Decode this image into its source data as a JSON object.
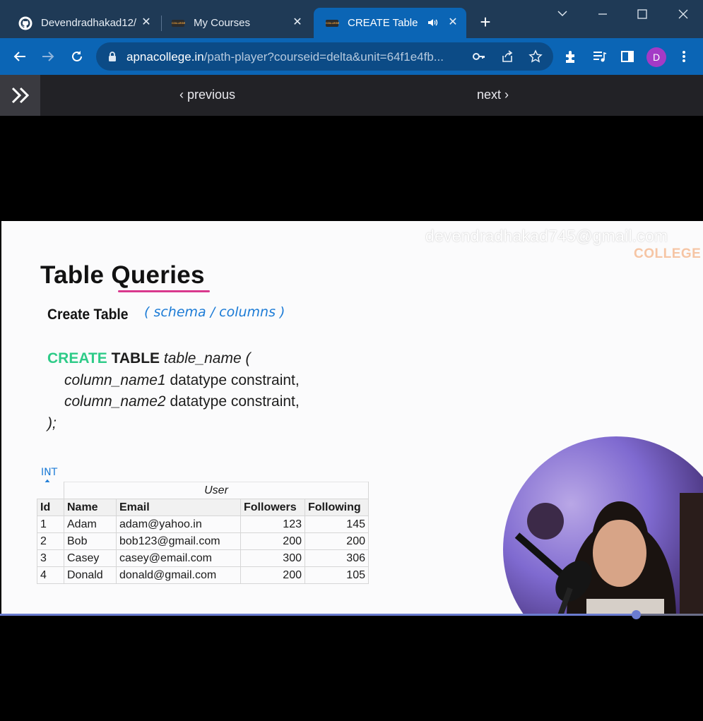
{
  "browser": {
    "tabs": [
      {
        "title": "Devendradhakad12/",
        "favicon": "github-icon",
        "active": false
      },
      {
        "title": "My Courses",
        "favicon": "college-logo-icon",
        "active": false
      },
      {
        "title": "CREATE Table",
        "favicon": "college-logo-icon",
        "active": true,
        "audio": true
      }
    ],
    "url": {
      "host": "apnacollege.in",
      "path": "/path-player?courseid=delta&unit=64f1e4fb..."
    },
    "profile_initial": "D",
    "colors": {
      "tabstrip": "#1f3a56",
      "toolbar": "#0b65b5",
      "omnibox": "#0c4b86",
      "avatar": "#a43ac6"
    }
  },
  "player": {
    "previous_label": "previous",
    "next_label": "next",
    "progress": 0.905
  },
  "slide": {
    "watermark_email": "devendradhakad745@gmail.com",
    "watermark_brand": "COLLEGE",
    "title": "Table Queries",
    "subtitle": "Create Table",
    "handwritten_note": "( schema / columns )",
    "int_note": "INT",
    "code": {
      "kw_create": "CREATE",
      "kw_table": "TABLE",
      "table_name": "table_name (",
      "col1": "column_name1",
      "col2": "column_name2",
      "col_rest": "datatype constraint,",
      "closing": ");"
    },
    "table": {
      "caption": "User",
      "headers": [
        "Id",
        "Name",
        "Email",
        "Followers",
        "Following"
      ],
      "rows": [
        [
          "1",
          "Adam",
          "adam@yahoo.in",
          "123",
          "145"
        ],
        [
          "2",
          "Bob",
          "bob123@gmail.com",
          "200",
          "200"
        ],
        [
          "3",
          "Casey",
          "casey@email.com",
          "300",
          "306"
        ],
        [
          "4",
          "Donald",
          "donald@gmail.com",
          "200",
          "105"
        ]
      ]
    }
  }
}
